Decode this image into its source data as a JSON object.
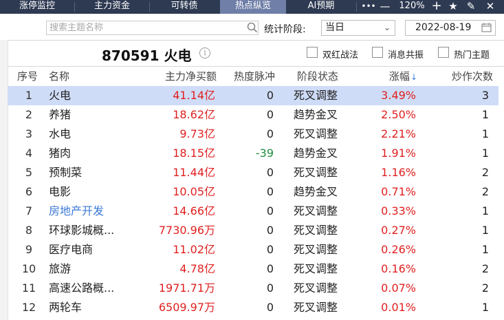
{
  "tabs": [
    {
      "label": "涨停监控",
      "active": false
    },
    {
      "label": "主力资金",
      "active": false
    },
    {
      "label": "可转债",
      "active": false
    },
    {
      "label": "热点纵览",
      "active": true
    },
    {
      "label": "AI预期",
      "active": false
    }
  ],
  "window_controls": {
    "more": "•••",
    "minimize": "—",
    "zoom": "120%",
    "add": "+",
    "star": "★",
    "edit": "✎",
    "close": "✕"
  },
  "filters": {
    "search_placeholder": "搜索主题名称",
    "period_label": "统计阶段:",
    "period_value": "当日",
    "date_value": "2022-08-19"
  },
  "title": {
    "code_name": "870591 火电",
    "options": [
      {
        "label": "双红战法",
        "checked": false
      },
      {
        "label": "消息共振",
        "checked": false
      },
      {
        "label": "热门主题",
        "checked": false
      }
    ]
  },
  "table": {
    "headers": {
      "idx": "序号",
      "name": "名称",
      "buy": "主力净买额",
      "heat": "热度脉冲",
      "stage": "阶段状态",
      "chg": "涨幅",
      "cnt": "炒作次数"
    },
    "sort_icon": "↓",
    "rows": [
      {
        "idx": "1",
        "name": "火电",
        "buy": "41.14亿",
        "heat": "0",
        "stage": "死叉调整",
        "chg": "3.49%",
        "cnt": "3",
        "selected": true
      },
      {
        "idx": "2",
        "name": "养猪",
        "buy": "18.62亿",
        "heat": "0",
        "stage": "趋势金叉",
        "chg": "2.50%",
        "cnt": "1"
      },
      {
        "idx": "3",
        "name": "水电",
        "buy": "9.73亿",
        "heat": "0",
        "stage": "死叉调整",
        "chg": "2.21%",
        "cnt": "1"
      },
      {
        "idx": "4",
        "name": "猪肉",
        "buy": "18.15亿",
        "heat": "-39",
        "stage": "趋势金叉",
        "chg": "1.91%",
        "cnt": "1",
        "heat_negative": true
      },
      {
        "idx": "5",
        "name": "预制菜",
        "buy": "11.44亿",
        "heat": "0",
        "stage": "死叉调整",
        "chg": "1.16%",
        "cnt": "2"
      },
      {
        "idx": "6",
        "name": "电影",
        "buy": "10.05亿",
        "heat": "0",
        "stage": "趋势金叉",
        "chg": "0.71%",
        "cnt": "2"
      },
      {
        "idx": "7",
        "name": "房地产开发",
        "buy": "14.66亿",
        "heat": "0",
        "stage": "死叉调整",
        "chg": "0.33%",
        "cnt": "1",
        "link": true
      },
      {
        "idx": "8",
        "name": "环球影城概...",
        "buy": "7730.96万",
        "heat": "0",
        "stage": "死叉调整",
        "chg": "0.27%",
        "cnt": "1"
      },
      {
        "idx": "9",
        "name": "医疗电商",
        "buy": "11.02亿",
        "heat": "0",
        "stage": "死叉调整",
        "chg": "0.26%",
        "cnt": "1"
      },
      {
        "idx": "10",
        "name": "旅游",
        "buy": "4.78亿",
        "heat": "0",
        "stage": "死叉调整",
        "chg": "0.16%",
        "cnt": "2"
      },
      {
        "idx": "11",
        "name": "高速公路概...",
        "buy": "1971.71万",
        "heat": "0",
        "stage": "死叉调整",
        "chg": "0.07%",
        "cnt": "2"
      },
      {
        "idx": "12",
        "name": "两轮车",
        "buy": "6509.97万",
        "heat": "0",
        "stage": "死叉调整",
        "chg": "0.01%",
        "cnt": "1"
      }
    ]
  },
  "colors": {
    "rise": "#e02020",
    "fall": "#1e8e3e",
    "link": "#3b79d6",
    "selected_row": "#cfdcf7",
    "topbar": "#2e3a52",
    "active_tab": "#6f7fa8"
  }
}
